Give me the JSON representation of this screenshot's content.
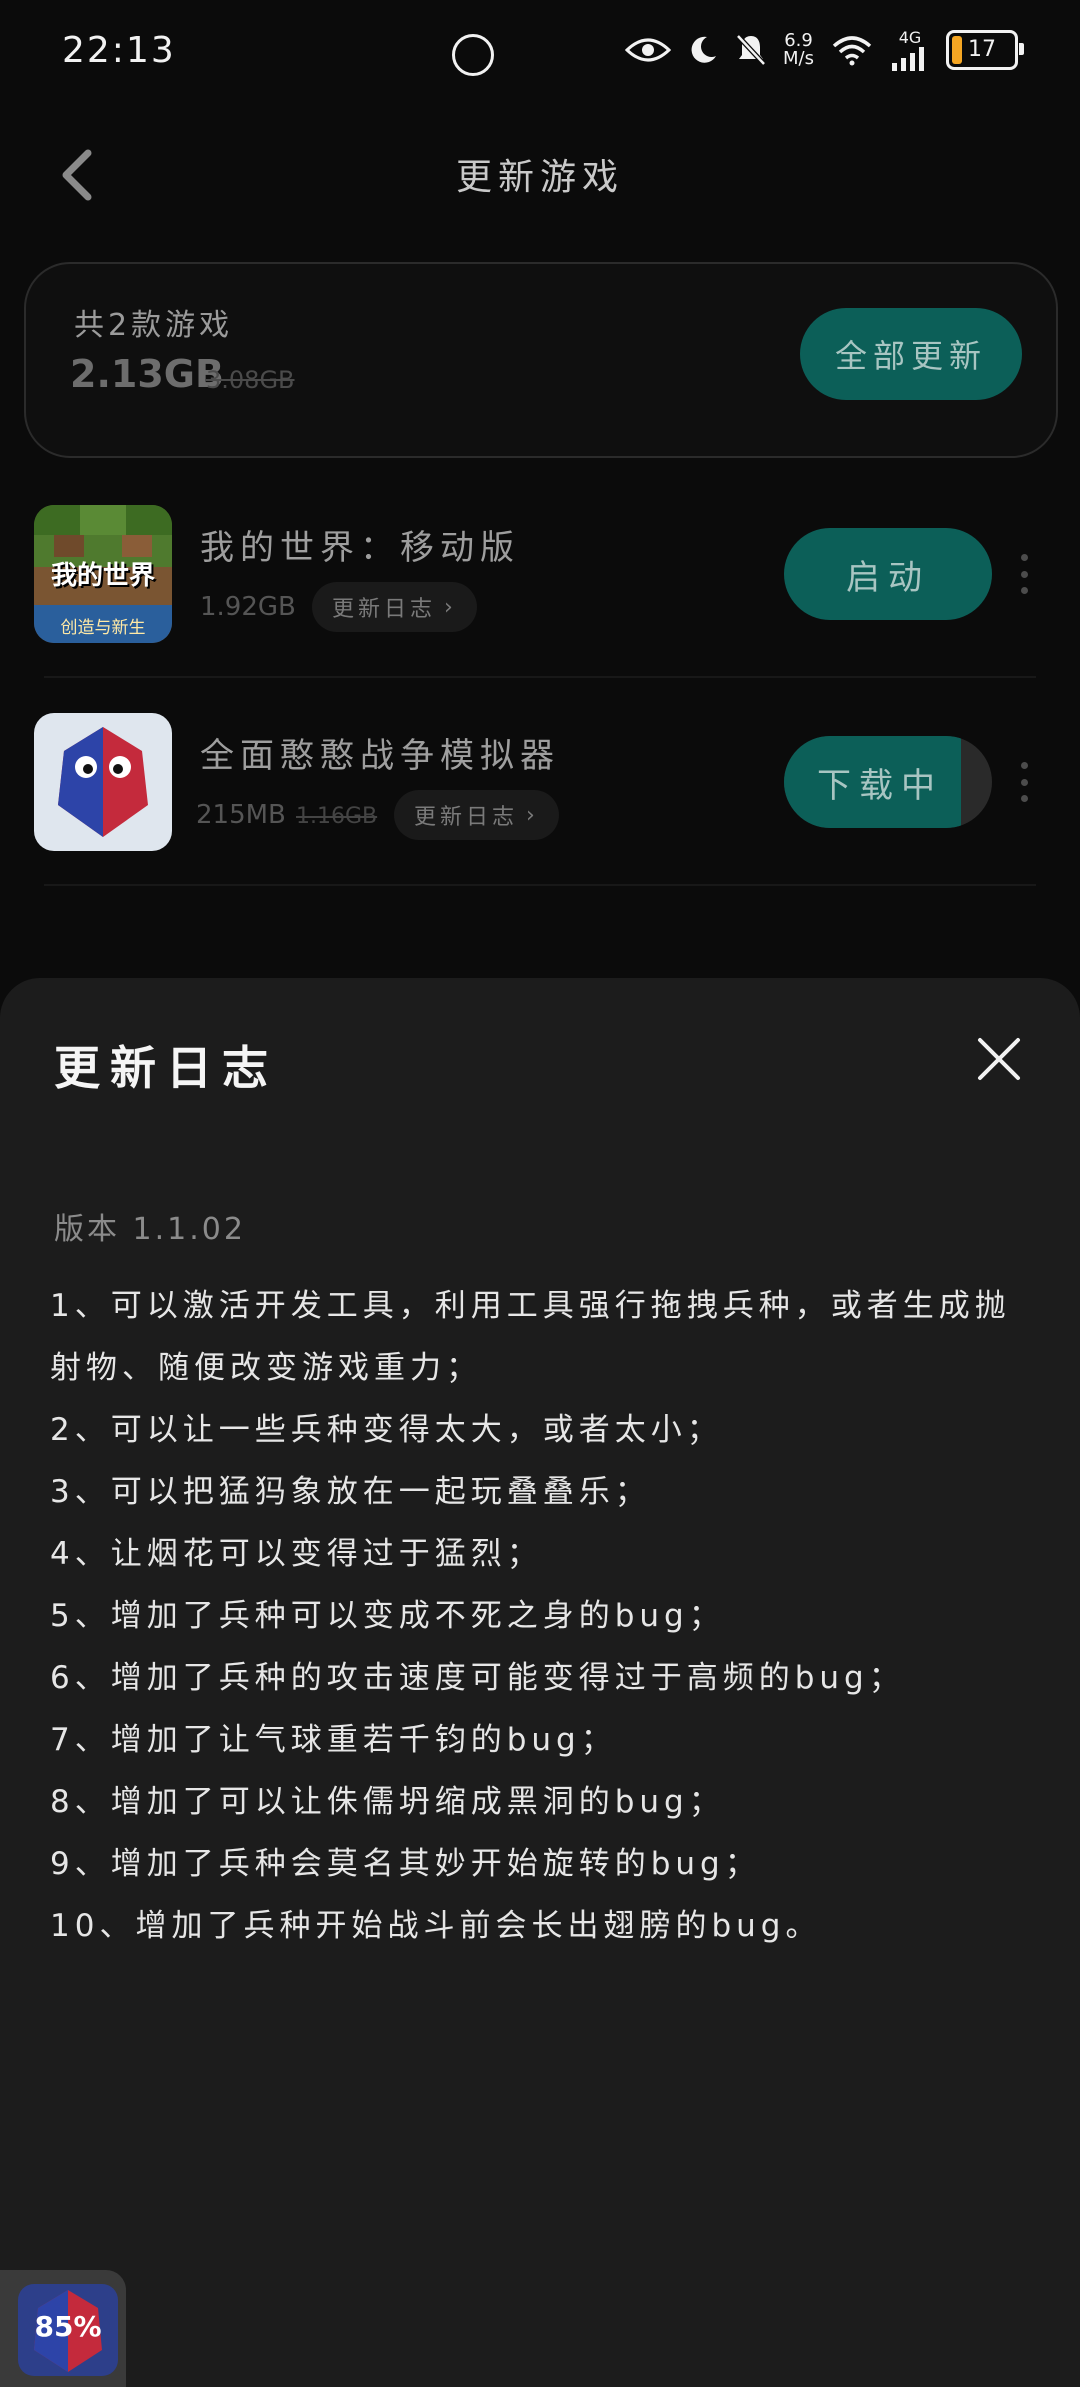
{
  "status_bar": {
    "time": "22:13",
    "speed": "6.9",
    "speed_unit": "M/s",
    "network": "4G",
    "battery": "17"
  },
  "header": {
    "title": "更新游戏"
  },
  "summary": {
    "count_label": "共2款游戏",
    "size": "2.13GB",
    "old_size": "3.08GB",
    "update_all_label": "全部更新"
  },
  "games": [
    {
      "name": "我的世界：移动版",
      "size": "1.92GB",
      "old_size": "",
      "log_label": "更新日志",
      "action_label": "启动",
      "icon_text_top": "我的世界",
      "icon_text_bottom": "创造与新生"
    },
    {
      "name": "全面憨憨战争模拟器",
      "size": "215MB",
      "old_size": "1.16GB",
      "log_label": "更新日志",
      "action_label": "下载中",
      "progress": 0.85
    }
  ],
  "sheet": {
    "title": "更新日志",
    "version": "版本 1.1.02",
    "items": [
      "1、可以激活开发工具，利用工具强行拖拽兵种，或者生成抛射物、随便改变游戏重力；",
      "2、可以让一些兵种变得太大，或者太小；",
      "3、可以把猛犸象放在一起玩叠叠乐；",
      "4、让烟花可以变得过于猛烈；",
      "5、增加了兵种可以变成不死之身的bug；",
      "6、增加了兵种的攻击速度可能变得过于高频的bug；",
      "7、增加了让气球重若千钧的bug；",
      "8、增加了可以让侏儒坍缩成黑洞的bug；",
      "9、增加了兵种会莫名其妙开始旋转的bug；",
      "10、增加了兵种开始战斗前会长出翅膀的bug。"
    ]
  },
  "floating": {
    "progress_label": "85%"
  },
  "colors": {
    "accent": "#0c5f58",
    "background": "#0b0b0b",
    "sheet": "#1c1c1c",
    "battery": "#f5a623"
  }
}
